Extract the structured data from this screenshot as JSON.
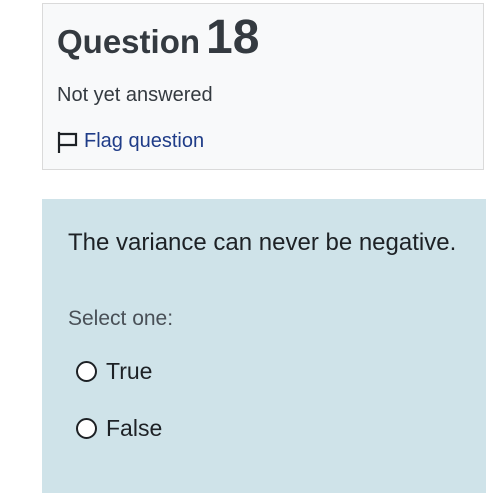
{
  "question_info": {
    "question_word": "Question",
    "question_number": "18",
    "status": "Not yet answered",
    "flag_label": "Flag question"
  },
  "content": {
    "question_text": "The variance can never be negative.",
    "prompt": "Select one:",
    "options": [
      {
        "label": "True",
        "selected": false
      },
      {
        "label": "False",
        "selected": false
      }
    ]
  },
  "colors": {
    "info_background": "#f8f9fa",
    "content_background": "#cfe3e9",
    "link": "#1f3c88",
    "text": "#343a40"
  },
  "icons": {
    "flag": "flag-outline-icon",
    "radio": "radio-unchecked-icon"
  }
}
